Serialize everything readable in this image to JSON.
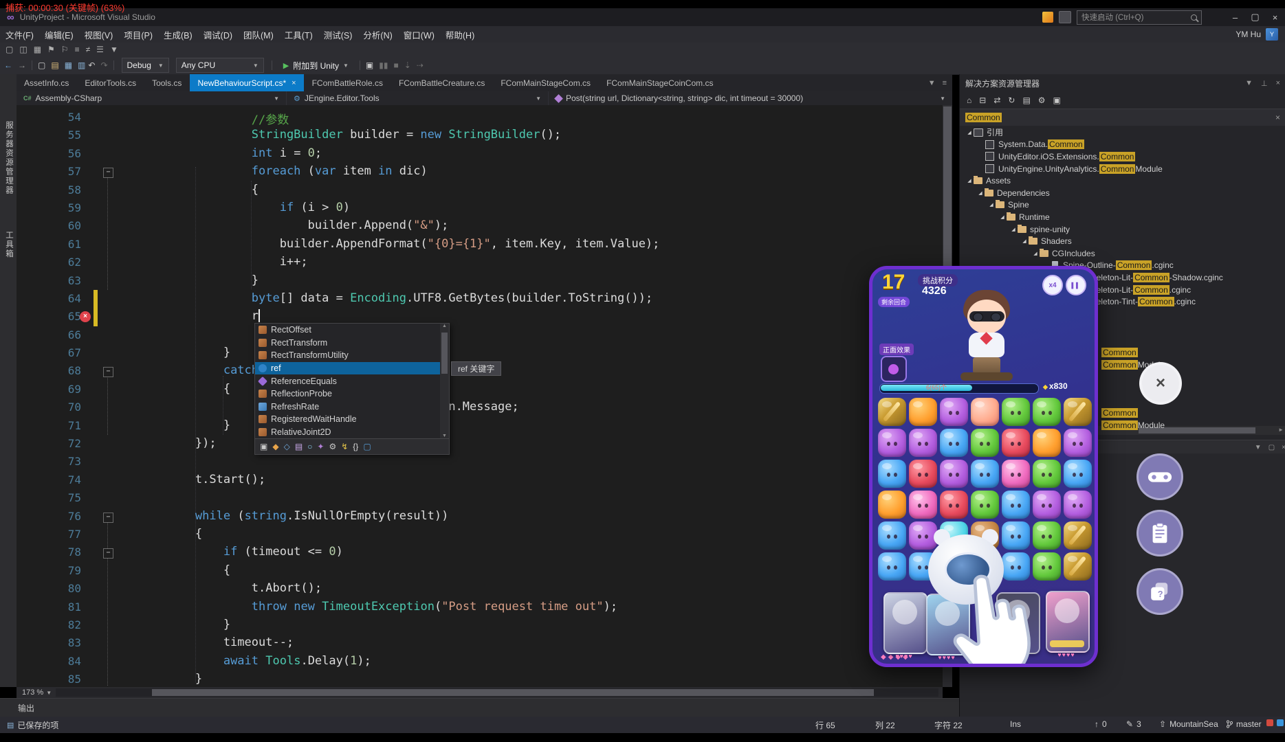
{
  "capture": {
    "text": "捕获: 00:00:30 (关键帧) (63%)"
  },
  "title_bar": {
    "title": "UnityProject - Microsoft Visual Studio",
    "quick_launch": "快速启动 (Ctrl+Q)",
    "user": "YM Hu",
    "minimize": "–",
    "maximize": "▢",
    "close": "×"
  },
  "menu": {
    "items": [
      "文件(F)",
      "编辑(E)",
      "视图(V)",
      "项目(P)",
      "生成(B)",
      "调试(D)",
      "团队(M)",
      "工具(T)",
      "测试(S)",
      "分析(N)",
      "窗口(W)",
      "帮助(H)"
    ]
  },
  "toolbar_small": {
    "icons": [
      "new-window",
      "split-window",
      "layout-grid",
      "bookmark",
      "bookmark-next",
      "comment-block",
      "uncomment-block",
      "outline",
      "more-options"
    ]
  },
  "toolbar_main": {
    "nav_icons": [
      "back",
      "forward"
    ],
    "file_icons": [
      "new-file",
      "open-file",
      "save",
      "save-all"
    ],
    "edit_icons": [
      "undo",
      "redo"
    ],
    "debug_label": "Debug",
    "platform_label": "Any CPU",
    "attach_label": "附加到 Unity",
    "extra_icons": [
      "build",
      "pause",
      "stop",
      "step-into",
      "step-over"
    ]
  },
  "side_tabs": {
    "items": [
      "服务器资源管理器",
      "工具箱"
    ]
  },
  "tabs": {
    "items": [
      {
        "label": "AssetInfo.cs"
      },
      {
        "label": "EditorTools.cs"
      },
      {
        "label": "Tools.cs"
      },
      {
        "label": "NewBehaviourScript.cs*",
        "active": true
      },
      {
        "label": "FComBattleRole.cs"
      },
      {
        "label": "FComBattleCreature.cs"
      },
      {
        "label": "FComMainStageCom.cs"
      },
      {
        "label": "FComMainStageCoinCom.cs"
      }
    ]
  },
  "breadcrumb": {
    "project": "Assembly-CSharp",
    "namespace": "JEngine.Editor.Tools",
    "member": "Post(string url, Dictionary<string, string> dic, int timeout = 30000)"
  },
  "editor": {
    "lines": [
      {
        "n": 54,
        "segs": [
          [
            "p",
            "                "
          ],
          [
            "c",
            "//参数"
          ]
        ]
      },
      {
        "n": 55,
        "segs": [
          [
            "p",
            "                "
          ],
          [
            "t",
            "StringBuilder"
          ],
          [
            "p",
            " builder = "
          ],
          [
            "k",
            "new"
          ],
          [
            "p",
            " "
          ],
          [
            "t",
            "StringBuilder"
          ],
          [
            "p",
            "();"
          ]
        ]
      },
      {
        "n": 56,
        "segs": [
          [
            "p",
            "                "
          ],
          [
            "k",
            "int"
          ],
          [
            "p",
            " i = "
          ],
          [
            "n",
            "0"
          ],
          [
            "p",
            ";"
          ]
        ]
      },
      {
        "n": 57,
        "fold": true,
        "segs": [
          [
            "p",
            "                "
          ],
          [
            "k",
            "foreach"
          ],
          [
            "p",
            " ("
          ],
          [
            "k",
            "var"
          ],
          [
            "p",
            " item "
          ],
          [
            "k",
            "in"
          ],
          [
            "p",
            " dic)"
          ]
        ]
      },
      {
        "n": 58,
        "segs": [
          [
            "p",
            "                {"
          ]
        ]
      },
      {
        "n": 59,
        "segs": [
          [
            "p",
            "                    "
          ],
          [
            "k",
            "if"
          ],
          [
            "p",
            " (i > "
          ],
          [
            "n",
            "0"
          ],
          [
            "p",
            ")"
          ]
        ]
      },
      {
        "n": 60,
        "segs": [
          [
            "p",
            "                        builder.Append("
          ],
          [
            "s",
            "\"&\""
          ],
          [
            "p",
            ");"
          ]
        ]
      },
      {
        "n": 61,
        "segs": [
          [
            "p",
            "                    builder.AppendFormat("
          ],
          [
            "s",
            "\"{0}={1}\""
          ],
          [
            "p",
            ", item.Key, item.Value);"
          ]
        ]
      },
      {
        "n": 62,
        "segs": [
          [
            "p",
            "                    i++;"
          ]
        ]
      },
      {
        "n": 63,
        "segs": [
          [
            "p",
            "                }"
          ]
        ]
      },
      {
        "n": 64,
        "chg": true,
        "segs": [
          [
            "p",
            "                "
          ],
          [
            "k",
            "byte"
          ],
          [
            "p",
            "[] data = "
          ],
          [
            "t",
            "Encoding"
          ],
          [
            "p",
            ".UTF8.GetBytes(builder.ToString());"
          ]
        ]
      },
      {
        "n": 65,
        "chg": true,
        "err": true,
        "caret": true,
        "segs": [
          [
            "p",
            "                r"
          ]
        ]
      },
      {
        "n": 66,
        "segs": []
      },
      {
        "n": 67,
        "segs": [
          [
            "p",
            "            }"
          ]
        ]
      },
      {
        "n": 68,
        "fold": true,
        "segs": [
          [
            "p",
            "            "
          ],
          [
            "k",
            "catch"
          ],
          [
            "p",
            " ("
          ],
          [
            "t",
            "Exception"
          ],
          [
            "p",
            " e)"
          ]
        ]
      },
      {
        "n": 69,
        "segs": [
          [
            "p",
            "            {"
          ]
        ]
      },
      {
        "n": 70,
        "segs": [
          [
            "p",
            "                    result = e.InnerException.Message;"
          ]
        ]
      },
      {
        "n": 71,
        "segs": [
          [
            "p",
            "            }"
          ]
        ]
      },
      {
        "n": 72,
        "segs": [
          [
            "p",
            "        });"
          ]
        ]
      },
      {
        "n": 73,
        "segs": []
      },
      {
        "n": 74,
        "segs": [
          [
            "p",
            "        t.Start();"
          ]
        ]
      },
      {
        "n": 75,
        "segs": []
      },
      {
        "n": 76,
        "fold": true,
        "segs": [
          [
            "p",
            "        "
          ],
          [
            "k",
            "while"
          ],
          [
            "p",
            " ("
          ],
          [
            "k",
            "string"
          ],
          [
            "p",
            ".IsNullOrEmpty(result))"
          ]
        ]
      },
      {
        "n": 77,
        "segs": [
          [
            "p",
            "        {"
          ]
        ]
      },
      {
        "n": 78,
        "fold": true,
        "segs": [
          [
            "p",
            "            "
          ],
          [
            "k",
            "if"
          ],
          [
            "p",
            " (timeout <= "
          ],
          [
            "n",
            "0"
          ],
          [
            "p",
            ")"
          ]
        ]
      },
      {
        "n": 79,
        "segs": [
          [
            "p",
            "            {"
          ]
        ]
      },
      {
        "n": 80,
        "segs": [
          [
            "p",
            "                t.Abort();"
          ]
        ]
      },
      {
        "n": 81,
        "segs": [
          [
            "p",
            "                "
          ],
          [
            "k",
            "throw"
          ],
          [
            "p",
            " "
          ],
          [
            "k",
            "new"
          ],
          [
            "p",
            " "
          ],
          [
            "t",
            "TimeoutException"
          ],
          [
            "p",
            "("
          ],
          [
            "s",
            "\"Post request time out\""
          ],
          [
            "p",
            ");"
          ]
        ]
      },
      {
        "n": 82,
        "segs": [
          [
            "p",
            "            }"
          ]
        ]
      },
      {
        "n": 83,
        "segs": [
          [
            "p",
            "            timeout--;"
          ]
        ]
      },
      {
        "n": 84,
        "segs": [
          [
            "p",
            "            "
          ],
          [
            "k",
            "await"
          ],
          [
            "p",
            " "
          ],
          [
            "t",
            "Tools"
          ],
          [
            "p",
            ".Delay("
          ],
          [
            "n",
            "1"
          ],
          [
            "p",
            ");"
          ]
        ]
      },
      {
        "n": 85,
        "segs": [
          [
            "p",
            "        }"
          ]
        ]
      }
    ]
  },
  "intellisense": {
    "items": [
      {
        "label": "RectOffset",
        "kind": "class"
      },
      {
        "label": "RectTransform",
        "kind": "class"
      },
      {
        "label": "RectTransformUtility",
        "kind": "class"
      },
      {
        "label": "ref",
        "kind": "keyword",
        "selected": true
      },
      {
        "label": "ReferenceEquals",
        "kind": "method"
      },
      {
        "label": "ReflectionProbe",
        "kind": "class"
      },
      {
        "label": "RefreshRate",
        "kind": "struct"
      },
      {
        "label": "RegisteredWaitHandle",
        "kind": "class"
      },
      {
        "label": "RelativeJoint2D",
        "kind": "class"
      }
    ],
    "tooltip": "ref 关键字",
    "filter_icons": [
      "all",
      "classes",
      "structs",
      "enums",
      "interfaces",
      "methods",
      "properties",
      "events",
      "snippets",
      "keywords"
    ]
  },
  "solution_explorer": {
    "title": "解决方案资源管理器",
    "toolbar_icons": [
      "home",
      "collapse-all",
      "sync-active",
      "refresh",
      "show-all-files",
      "properties",
      "preview"
    ],
    "search_text": "Common",
    "tree": [
      {
        "d": 0,
        "icon": "refs",
        "arrow": true,
        "pre": "引用",
        "hl": "",
        "post": ""
      },
      {
        "d": 1,
        "icon": "asm",
        "pre": "System.Data.",
        "hl": "Common",
        "post": ""
      },
      {
        "d": 1,
        "icon": "asm",
        "pre": "UnityEditor.iOS.Extensions.",
        "hl": "Common",
        "post": ""
      },
      {
        "d": 1,
        "icon": "asm",
        "pre": "UnityEngine.UnityAnalytics.",
        "hl": "Common",
        "post": "Module"
      },
      {
        "d": 0,
        "icon": "folder",
        "arrow": true,
        "pre": "Assets",
        "hl": "",
        "post": ""
      },
      {
        "d": 1,
        "icon": "folder",
        "arrow": true,
        "pre": "Dependencies",
        "hl": "",
        "post": ""
      },
      {
        "d": 2,
        "icon": "folder",
        "arrow": true,
        "pre": "Spine",
        "hl": "",
        "post": ""
      },
      {
        "d": 3,
        "icon": "folder",
        "arrow": true,
        "pre": "Runtime",
        "hl": "",
        "post": ""
      },
      {
        "d": 4,
        "icon": "folder",
        "arrow": true,
        "pre": "spine-unity",
        "hl": "",
        "post": ""
      },
      {
        "d": 5,
        "icon": "folder",
        "arrow": true,
        "pre": "Shaders",
        "hl": "",
        "post": ""
      },
      {
        "d": 6,
        "icon": "folder",
        "arrow": true,
        "pre": "CGIncludes",
        "hl": "",
        "post": ""
      },
      {
        "d": 7,
        "icon": "file",
        "pre": "Spine-Outline-",
        "hl": "Common",
        "post": ".cginc"
      },
      {
        "d": 7,
        "icon": "file",
        "pre": "Spine-Skeleton-Lit-",
        "hl": "Common",
        "post": "-Shadow.cginc"
      },
      {
        "d": 7,
        "icon": "file",
        "pre": "Spine-Skeleton-Lit-",
        "hl": "Common",
        "post": ".cginc"
      },
      {
        "d": 7,
        "icon": "file",
        "pre": "Spine-Skeleton-Tint-",
        "hl": "Common",
        "post": ".cginc"
      }
    ],
    "fragments": [
      {
        "hl": "Common",
        "post": ""
      },
      {
        "hl": "Common",
        "post": "Module"
      },
      {
        "hl": "Common",
        "post": ""
      },
      {
        "hl": "Common",
        "post": "Module"
      }
    ]
  },
  "game": {
    "score_label": "挑战积分",
    "score": "4326",
    "moves": "17",
    "moves_label": "剩余回合",
    "multiplier": "x4",
    "effect_label": "正面效果",
    "progress_text": "6(65)个",
    "progress_right": "x830",
    "grid": [
      "WOPHGGW",
      "PPBGROP",
      "BRPBKGB",
      "OKRGBPP",
      "BPCNBGW",
      "BBBGBGW"
    ],
    "cards": [
      {
        "color": "#cdd4e4"
      },
      {
        "color": "#9fd4ef"
      },
      {
        "color": "#4a4a5e"
      },
      {
        "color": "#f0a0cc"
      }
    ],
    "card_stars": "♥♥♥♥",
    "bottom_dots": "◆◆◆◆"
  },
  "overlay_buttons": {
    "icons": [
      "close",
      "gamepad",
      "clipboard",
      "dice"
    ]
  },
  "bottom": {
    "zoom": "173 %",
    "output": "输出"
  },
  "status_bar": {
    "saved": "已保存的项",
    "line": "行 65",
    "column": "列 22",
    "character": "字符 22",
    "insert_mode": "Ins",
    "outgoing": "0",
    "pending": "3",
    "repo": "MountainSea",
    "branch": "master"
  }
}
